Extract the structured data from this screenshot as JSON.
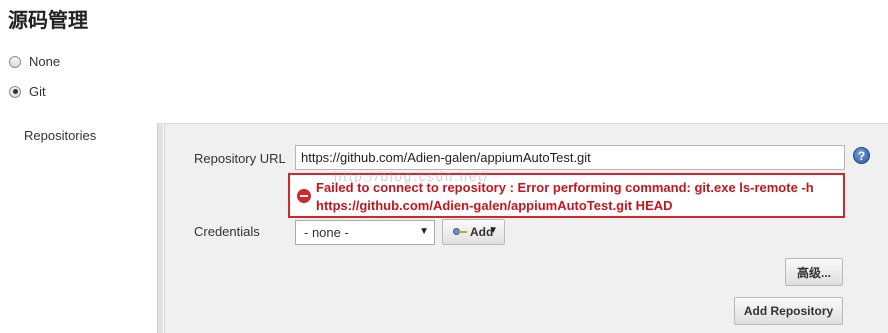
{
  "section": {
    "title": "源码管理"
  },
  "scm_options": [
    {
      "label": "None",
      "checked": false
    },
    {
      "label": "Git",
      "checked": true
    }
  ],
  "repositories": {
    "label": "Repositories",
    "url_label": "Repository URL",
    "url_value": "https://github.com/Adien-galen/appiumAutoTest.git",
    "error_line1": "Failed to connect to repository : Error performing command: git.exe ls-remote -h",
    "error_line2": "https://github.com/Adien-galen/appiumAutoTest.git HEAD",
    "watermark": "http://blog.csdn.net/",
    "credentials_label": "Credentials",
    "credentials_selected": "- none -",
    "add_label": "Add",
    "advanced_label": "高级...",
    "add_repository_label": "Add Repository"
  },
  "colors": {
    "error": "#d2272c",
    "panel": "#f0f0f0"
  }
}
